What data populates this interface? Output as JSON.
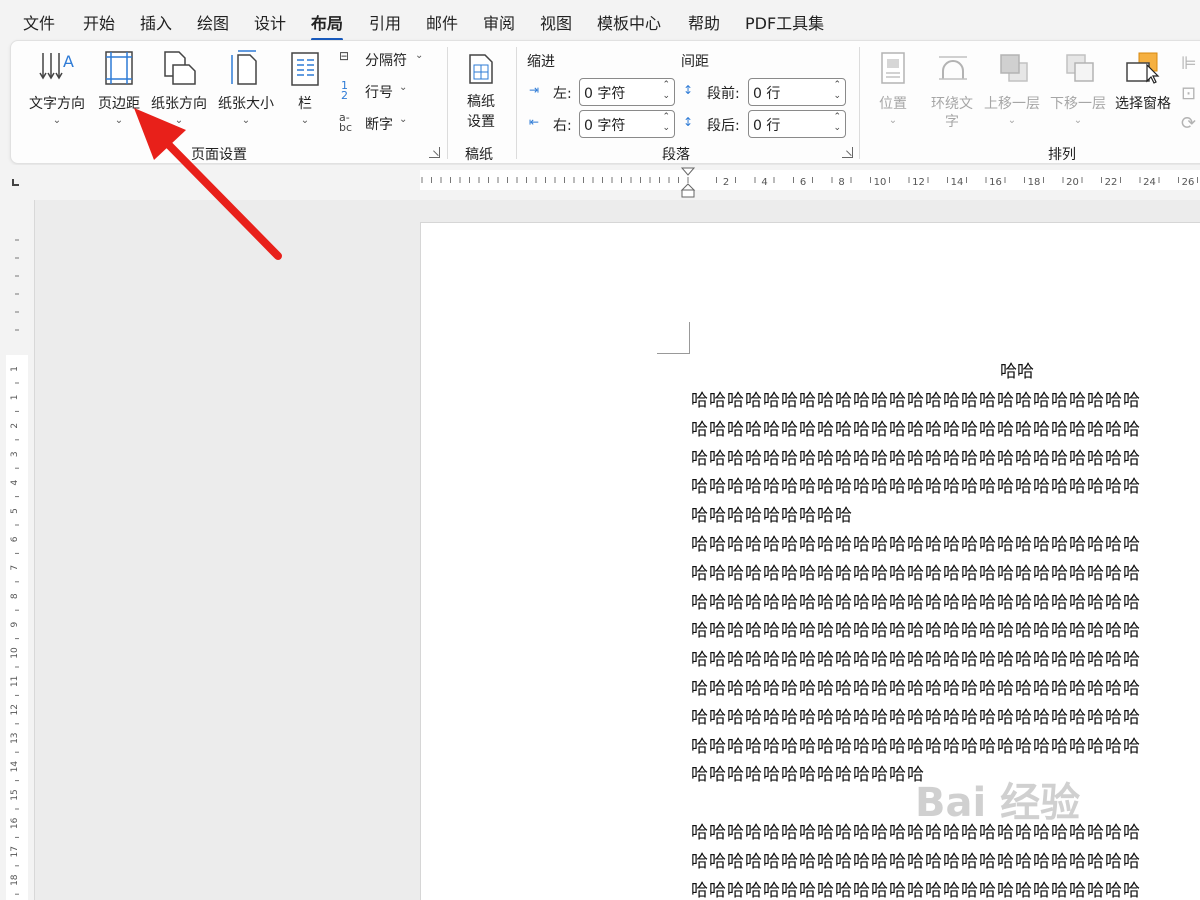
{
  "menu": {
    "tabs": [
      "文件",
      "开始",
      "插入",
      "绘图",
      "设计",
      "布局",
      "引用",
      "邮件",
      "审阅",
      "视图",
      "模板中心",
      "帮助",
      "PDF工具集"
    ]
  },
  "ribbon": {
    "page_setup": {
      "text_direction": "文字方向",
      "margins": "页边距",
      "orientation": "纸张方向",
      "size": "纸张大小",
      "columns": "栏",
      "breaks": "分隔符",
      "line_numbers": "行号",
      "hyphenation": "断字",
      "group_label": "页面设置"
    },
    "manuscript": {
      "settings_line1": "稿纸",
      "settings_line2": "设置",
      "group_label": "稿纸"
    },
    "paragraph": {
      "indent_header": "缩进",
      "spacing_header": "间距",
      "left_label": "左:",
      "left_value": "0 字符",
      "right_label": "右:",
      "right_value": "0 字符",
      "before_label": "段前:",
      "before_value": "0 行",
      "after_label": "段后:",
      "after_value": "0 行",
      "group_label": "段落"
    },
    "arrange": {
      "position": "位置",
      "wrap_line1": "环绕文",
      "wrap_line2": "字",
      "bring_forward": "上移一层",
      "send_backward": "下移一层",
      "selection_pane": "选择窗格",
      "group_label": "排列"
    }
  },
  "ruler": {
    "h_numbers": [
      "2",
      "4",
      "6",
      "8",
      "10",
      "12",
      "14",
      "16",
      "18",
      "20",
      "22",
      "24",
      "26"
    ],
    "v_numbers": [
      "1",
      "1",
      "2",
      "3",
      "4",
      "5",
      "6",
      "7",
      "8",
      "9",
      "10",
      "11",
      "12",
      "13",
      "14",
      "15",
      "16",
      "17",
      "18",
      "19"
    ]
  },
  "document": {
    "title": "哈哈",
    "lines": [
      "哈哈哈哈哈哈哈哈哈哈哈哈哈哈哈哈哈哈哈哈哈哈哈哈哈",
      "哈哈哈哈哈哈哈哈哈哈哈哈哈哈哈哈哈哈哈哈哈哈哈哈哈",
      "哈哈哈哈哈哈哈哈哈哈哈哈哈哈哈哈哈哈哈哈哈哈哈哈哈",
      "哈哈哈哈哈哈哈哈哈哈哈哈哈哈哈哈哈哈哈哈哈哈哈哈哈",
      "哈哈哈哈哈哈哈哈哈",
      "哈哈哈哈哈哈哈哈哈哈哈哈哈哈哈哈哈哈哈哈哈哈哈哈哈",
      "哈哈哈哈哈哈哈哈哈哈哈哈哈哈哈哈哈哈哈哈哈哈哈哈哈",
      "哈哈哈哈哈哈哈哈哈哈哈哈哈哈哈哈哈哈哈哈哈哈哈哈哈",
      "哈哈哈哈哈哈哈哈哈哈哈哈哈哈哈哈哈哈哈哈哈哈哈哈哈",
      "哈哈哈哈哈哈哈哈哈哈哈哈哈哈哈哈哈哈哈哈哈哈哈哈哈",
      "哈哈哈哈哈哈哈哈哈哈哈哈哈哈哈哈哈哈哈哈哈哈哈哈哈",
      "哈哈哈哈哈哈哈哈哈哈哈哈哈哈哈哈哈哈哈哈哈哈哈哈哈",
      "哈哈哈哈哈哈哈哈哈哈哈哈哈哈哈哈哈哈哈哈哈哈哈哈哈",
      "哈哈哈哈哈哈哈哈哈哈哈哈哈",
      "",
      "哈哈哈哈哈哈哈哈哈哈哈哈哈哈哈哈哈哈哈哈哈哈哈哈哈",
      "哈哈哈哈哈哈哈哈哈哈哈哈哈哈哈哈哈哈哈哈哈哈哈哈哈",
      "哈哈哈哈哈哈哈哈哈哈哈哈哈哈哈哈哈哈哈哈哈哈哈哈哈"
    ]
  },
  "watermark": "Bai 经验",
  "colors": {
    "accent": "#185abd",
    "arrow": "#e8201a",
    "icon_blue": "#2e7bd6"
  }
}
